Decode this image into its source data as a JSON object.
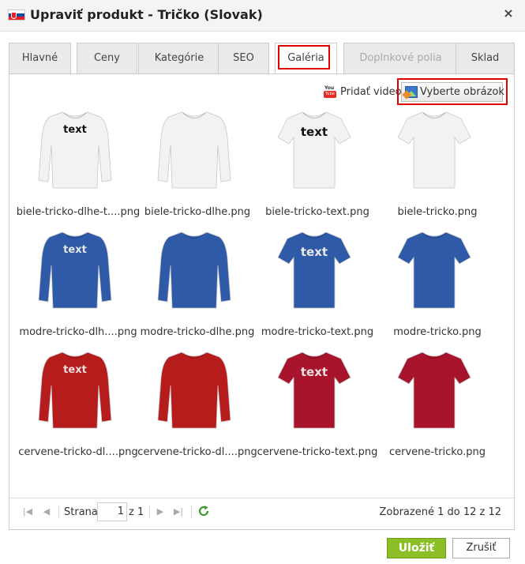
{
  "dialog": {
    "title": "Upraviť produkt - Tričko (Slovak)",
    "close_symbol": "×",
    "flag_icon": "slovak-flag-icon"
  },
  "tabs": [
    {
      "label": "Hlavné",
      "state": "normal"
    },
    {
      "label": "Ceny",
      "state": "normal"
    },
    {
      "label": "Kategórie",
      "state": "normal"
    },
    {
      "label": "SEO",
      "state": "normal"
    },
    {
      "label": "Galéria",
      "state": "active"
    },
    {
      "label": "Doplnkové polia",
      "state": "disabled"
    },
    {
      "label": "Sklad",
      "state": "normal"
    }
  ],
  "toolbar": {
    "video_icon": "youtube-icon",
    "video_icon_top": "You",
    "video_icon_bottom": "Tube",
    "add_video_label": "Pridať video",
    "select_image_label": "Vyberte obrázok",
    "select_image_icon": "image-icon"
  },
  "gallery": [
    {
      "filename": "biele-tricko-dlhe-t....png",
      "color": "#f2f2f2",
      "sleeves": "long",
      "text": "text",
      "text_color": "#111111"
    },
    {
      "filename": "biele-tricko-dlhe.png",
      "color": "#f2f2f2",
      "sleeves": "long",
      "text": "",
      "text_color": "#111111"
    },
    {
      "filename": "biele-tricko-text.png",
      "color": "#f2f2f2",
      "sleeves": "short",
      "text": "text",
      "text_color": "#111111"
    },
    {
      "filename": "biele-tricko.png",
      "color": "#f2f2f2",
      "sleeves": "short",
      "text": "",
      "text_color": "#111111"
    },
    {
      "filename": "modre-tricko-dlh....png",
      "color": "#2f5aa8",
      "sleeves": "long",
      "text": "text",
      "text_color": "#e8e8e8"
    },
    {
      "filename": "modre-tricko-dlhe.png",
      "color": "#2f5aa8",
      "sleeves": "long",
      "text": "",
      "text_color": "#e8e8e8"
    },
    {
      "filename": "modre-tricko-text.png",
      "color": "#2f5aa8",
      "sleeves": "short",
      "text": "text",
      "text_color": "#e8e8e8"
    },
    {
      "filename": "modre-tricko.png",
      "color": "#2f5aa8",
      "sleeves": "short",
      "text": "",
      "text_color": "#e8e8e8"
    },
    {
      "filename": "cervene-tricko-dl....png",
      "color": "#b71c1c",
      "sleeves": "long",
      "text": "text",
      "text_color": "#f0e0e0"
    },
    {
      "filename": "cervene-tricko-dl....png",
      "color": "#b71c1c",
      "sleeves": "long",
      "text": "",
      "text_color": "#f0e0e0"
    },
    {
      "filename": "cervene-tricko-text.png",
      "color": "#a8142c",
      "sleeves": "short",
      "text": "text",
      "text_color": "#f0e0e0"
    },
    {
      "filename": "cervene-tricko.png",
      "color": "#a8142c",
      "sleeves": "short",
      "text": "",
      "text_color": "#f0e0e0"
    }
  ],
  "pager": {
    "first_icon": "first-page-icon",
    "prev_icon": "prev-page-icon",
    "next_icon": "next-page-icon",
    "last_icon": "last-page-icon",
    "refresh_icon": "refresh-icon",
    "page_label": "Strana",
    "page_value": "1",
    "of_label": "z 1",
    "status": "Zobrazené 1 do 12 z 12"
  },
  "footer": {
    "save_label": "Uložiť",
    "cancel_label": "Zrušiť"
  },
  "colors": {
    "highlight": "#e00000",
    "save_button": "#8cbf26",
    "refresh": "#3a9a2a"
  }
}
